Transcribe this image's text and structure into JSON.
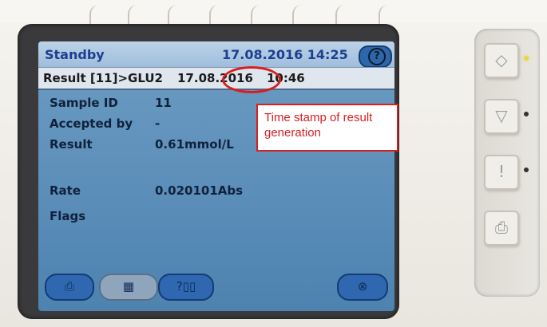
{
  "device": {
    "screen": {
      "title_bar": {
        "status": "Standby",
        "datetime": "17.08.2016 14:25",
        "help_icon": "?"
      },
      "result_header": {
        "label": "Result [11]>GLU2",
        "date": "17.08.2016",
        "time": "10:46"
      },
      "fields": [
        {
          "label": "Sample ID",
          "value": "11"
        },
        {
          "label": "Accepted by",
          "value": "-"
        },
        {
          "label": "Result",
          "value": "0.61mmol/L"
        },
        {
          "label": "Rate",
          "value": "0.020101Abs"
        },
        {
          "label": "Flags",
          "value": ""
        }
      ],
      "bottom_buttons": [
        {
          "name": "print-icon",
          "glyph": "⎙"
        },
        {
          "name": "calculator-icon",
          "glyph": "▦"
        },
        {
          "name": "query-icon",
          "glyph": "?▯▯"
        },
        {
          "name": "cancel-icon",
          "glyph": "⊗"
        }
      ]
    },
    "annotation": {
      "callout_text": "Time stamp of result generation",
      "highlight_color": "#d71f1f"
    },
    "side_keys": [
      {
        "name": "start-icon",
        "glyph": "◇",
        "led": "yellow"
      },
      {
        "name": "stop-icon",
        "glyph": "▽",
        "led": "dark"
      },
      {
        "name": "alert-icon",
        "glyph": "!",
        "led": "dark"
      },
      {
        "name": "printer-icon",
        "glyph": "⎙",
        "led": "none"
      }
    ]
  }
}
